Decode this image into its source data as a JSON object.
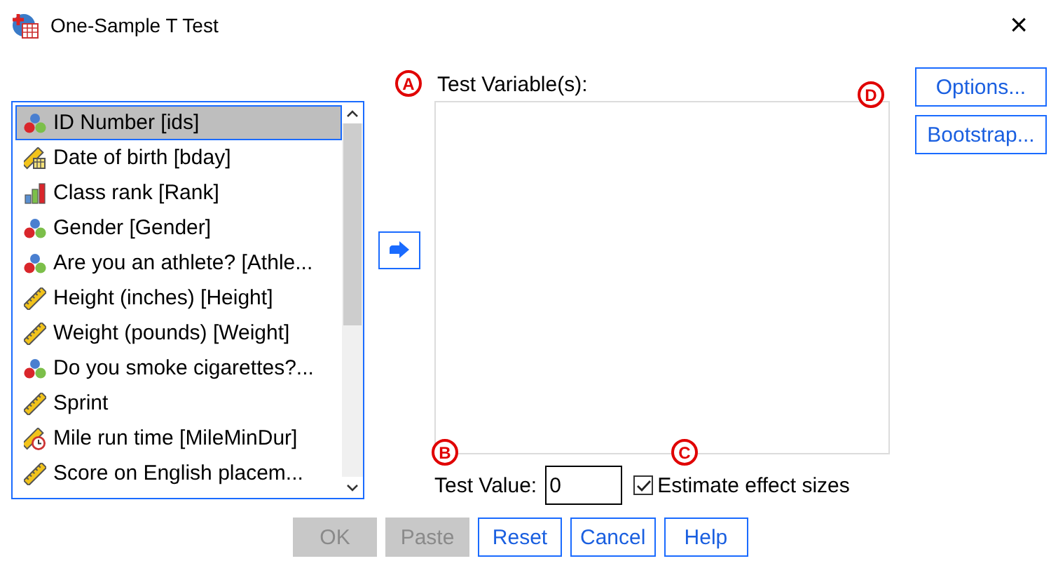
{
  "window": {
    "title": "One-Sample T Test",
    "close": "×"
  },
  "variables": [
    {
      "label": "ID Number [ids]",
      "kind": "nominal",
      "selected": true
    },
    {
      "label": "Date of birth [bday]",
      "kind": "date",
      "selected": false
    },
    {
      "label": "Class rank [Rank]",
      "kind": "ordinal",
      "selected": false
    },
    {
      "label": "Gender [Gender]",
      "kind": "nominal",
      "selected": false
    },
    {
      "label": "Are you an athlete? [Athle...",
      "kind": "nominal",
      "selected": false
    },
    {
      "label": "Height (inches) [Height]",
      "kind": "scale",
      "selected": false
    },
    {
      "label": "Weight (pounds) [Weight]",
      "kind": "scale",
      "selected": false
    },
    {
      "label": "Do you smoke cigarettes?...",
      "kind": "nominal",
      "selected": false
    },
    {
      "label": "Sprint",
      "kind": "scale",
      "selected": false
    },
    {
      "label": "Mile run time [MileMinDur]",
      "kind": "time",
      "selected": false
    },
    {
      "label": "Score on English placem...",
      "kind": "scale",
      "selected": false
    }
  ],
  "test_variables": {
    "label": "Test Variable(s):"
  },
  "side_buttons": [
    {
      "label": "Options..."
    },
    {
      "label": "Bootstrap..."
    }
  ],
  "test_value": {
    "label": "Test Value:",
    "value": "0"
  },
  "effect_sizes": {
    "label": "Estimate effect sizes",
    "checked": true
  },
  "buttons": [
    {
      "label": "OK",
      "disabled": true
    },
    {
      "label": "Paste",
      "disabled": true
    },
    {
      "label": "Reset",
      "disabled": false
    },
    {
      "label": "Cancel",
      "disabled": false
    },
    {
      "label": "Help",
      "disabled": false
    }
  ],
  "callouts": [
    {
      "letter": "A"
    },
    {
      "letter": "B"
    },
    {
      "letter": "C"
    },
    {
      "letter": "D"
    }
  ]
}
